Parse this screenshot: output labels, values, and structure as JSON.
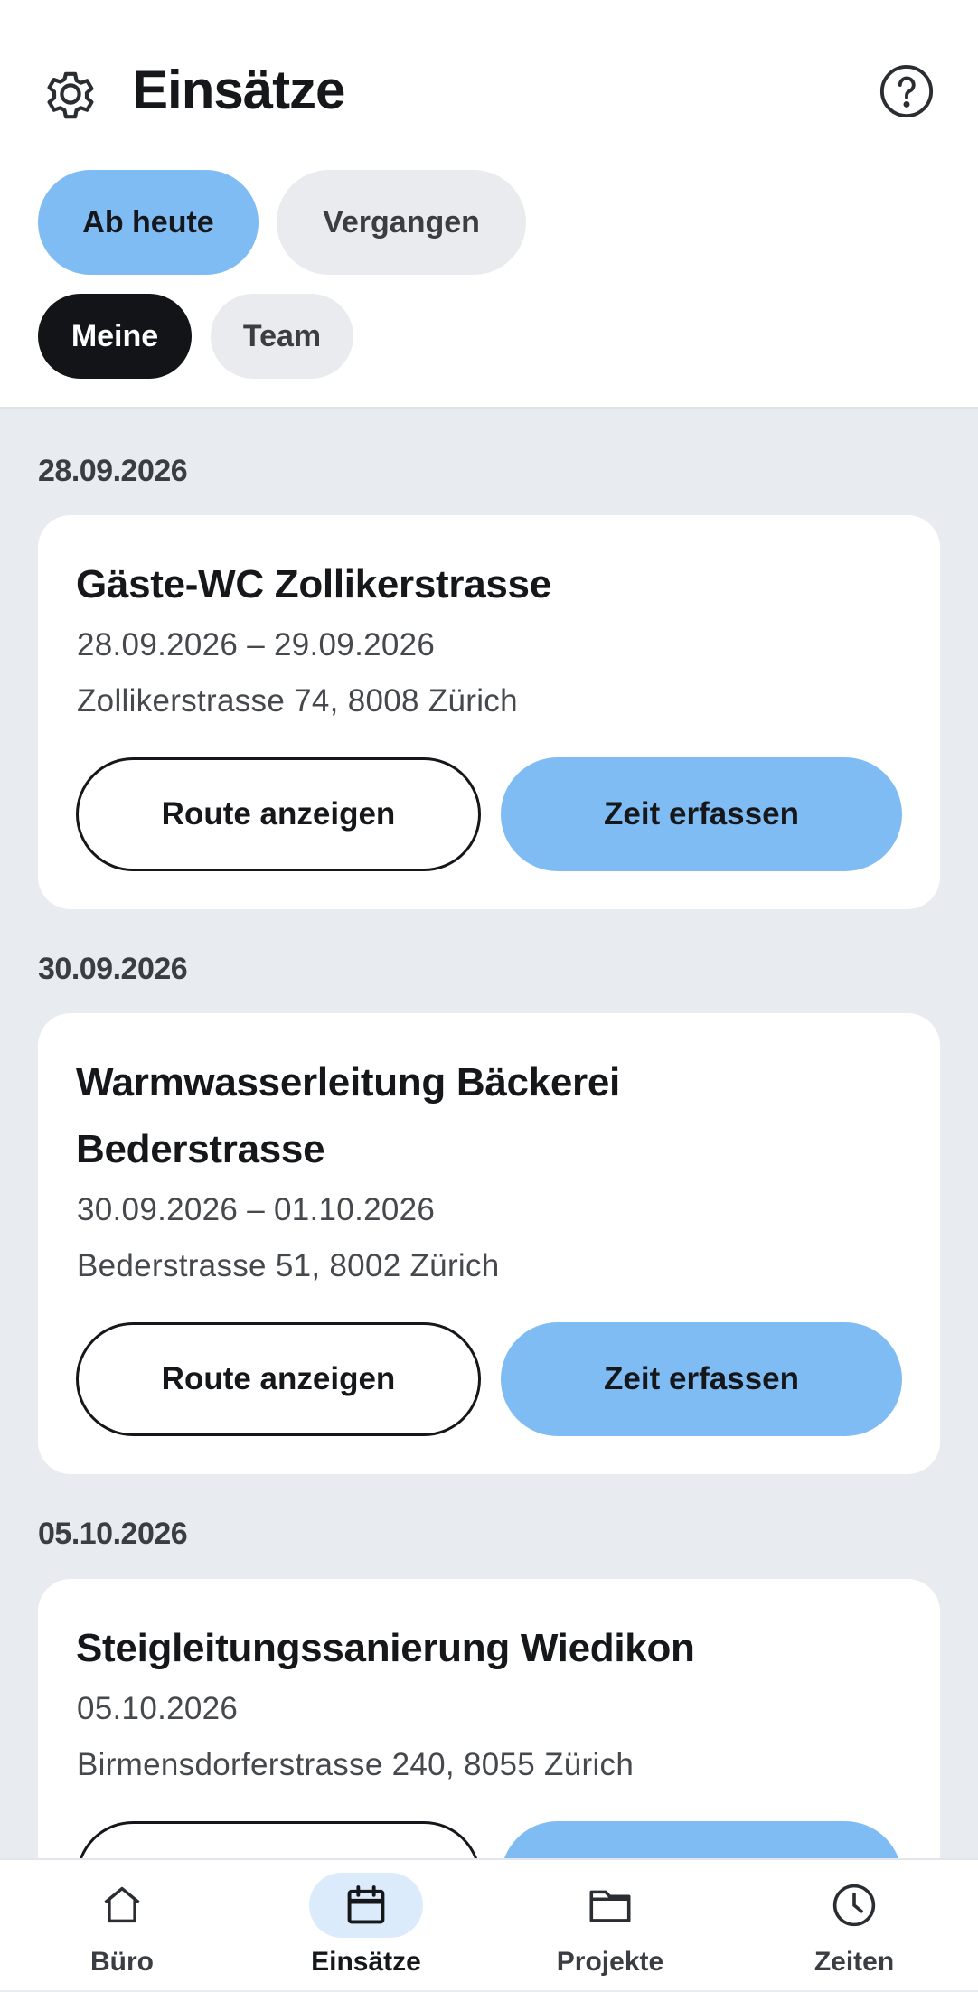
{
  "header": {
    "title": "Einsätze",
    "filters_time": [
      {
        "label": "Ab heute",
        "selected": true
      },
      {
        "label": "Vergangen",
        "selected": false
      }
    ],
    "filters_scope": [
      {
        "label": "Meine",
        "selected": true
      },
      {
        "label": "Team",
        "selected": false
      }
    ]
  },
  "groups": [
    {
      "date": "28.09.2026",
      "card": {
        "title": "Gäste-WC Zollikerstrasse",
        "date_range": "28.09.2026 – 29.09.2026",
        "address": "Zollikerstrasse 74, 8008 Zürich",
        "route_label": "Route anzeigen",
        "time_label": "Zeit erfassen"
      }
    },
    {
      "date": "30.09.2026",
      "card": {
        "title": "Warmwasserleitung Bäckerei Bederstrasse",
        "date_range": "30.09.2026 – 01.10.2026",
        "address": "Bederstrasse 51, 8002 Zürich",
        "route_label": "Route anzeigen",
        "time_label": "Zeit erfassen"
      }
    },
    {
      "date": "05.10.2026",
      "card": {
        "title": "Steigleitungssanierung Wiedikon",
        "date_range": "05.10.2026",
        "address": "Birmensdorferstrasse 240, 8055 Zürich"
      }
    }
  ],
  "bottom_nav": [
    {
      "label": "Büro",
      "icon": "home-icon",
      "active": false
    },
    {
      "label": "Einsätze",
      "icon": "calendar-icon",
      "active": true
    },
    {
      "label": "Projekte",
      "icon": "folder-icon",
      "active": false
    },
    {
      "label": "Zeiten",
      "icon": "clock-icon",
      "active": false
    }
  ],
  "colors": {
    "accent": "#80bcf4",
    "accent_light": "#dcebfb",
    "dark_chip": "#121417",
    "background": "#e8ebef"
  }
}
